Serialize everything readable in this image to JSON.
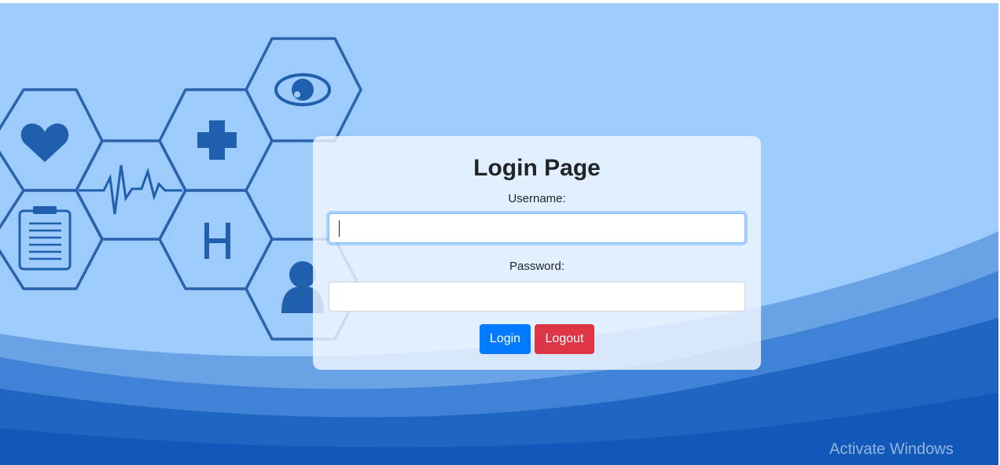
{
  "login": {
    "title": "Login Page",
    "username_label": "Username:",
    "username_value": "",
    "password_label": "Password:",
    "password_value": "",
    "login_button": "Login",
    "logout_button": "Logout"
  },
  "watermark": {
    "text": "Activate Windows"
  },
  "icons": [
    "heart-icon",
    "heartbeat-icon",
    "medical-cross-icon",
    "eye-icon",
    "clipboard-icon",
    "hospital-h-icon",
    "person-icon"
  ],
  "colors": {
    "sky": "#9ccbfb",
    "hexagon_stroke": "#2a62ad",
    "wave_dark": "#1158b8",
    "login_button": "#007bff",
    "logout_button": "#dc3545",
    "title_text": "#212529"
  }
}
